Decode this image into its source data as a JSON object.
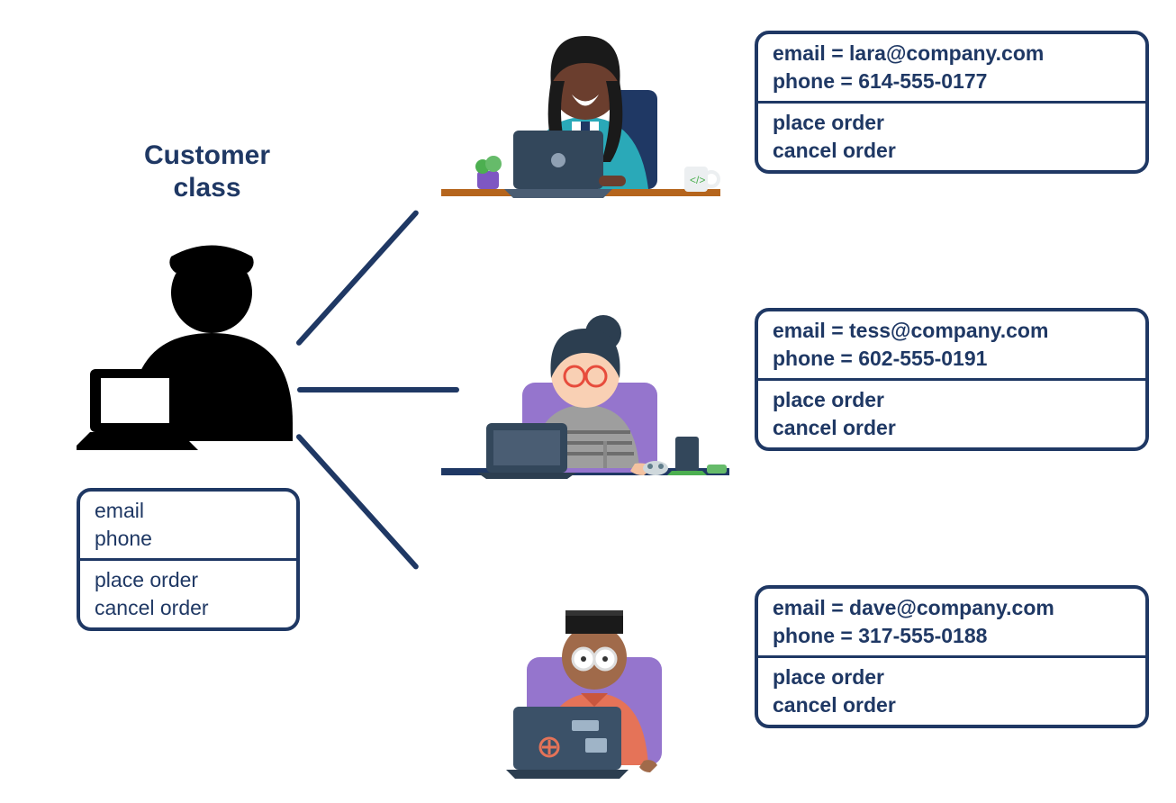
{
  "title_line1": "Customer",
  "title_line2": "class",
  "class_box": {
    "attr1": "email",
    "attr2": "phone",
    "method1": "place order",
    "method2": "cancel order"
  },
  "instances": [
    {
      "email_line": "email = lara@company.com",
      "phone_line": "phone = 614-555-0177",
      "method1": "place order",
      "method2": "cancel order"
    },
    {
      "email_line": "email = tess@company.com",
      "phone_line": "phone = 602-555-0191",
      "method1": "place order",
      "method2": "cancel order"
    },
    {
      "email_line": "email = dave@company.com",
      "phone_line": "phone = 317-555-0188",
      "method1": "place order",
      "method2": "cancel order"
    }
  ]
}
